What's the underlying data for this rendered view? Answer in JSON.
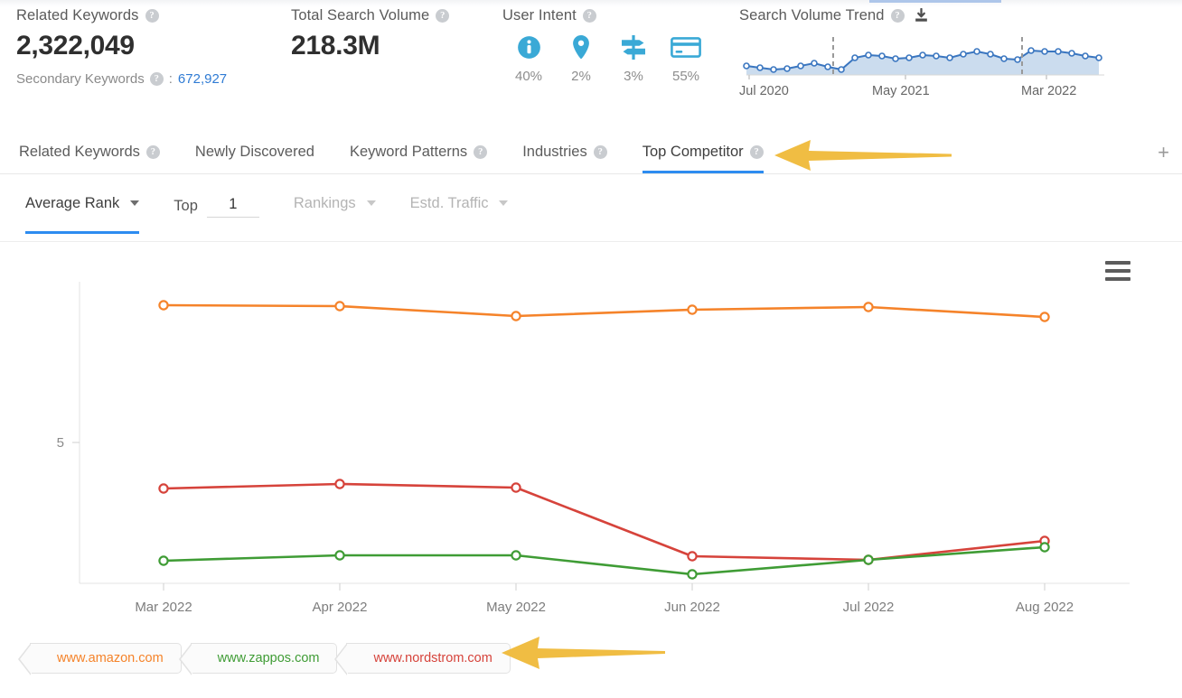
{
  "metrics": {
    "related_keywords": {
      "label": "Related Keywords",
      "value": "2,322,049",
      "secondary_label": "Secondary Keywords",
      "secondary_sep": ":",
      "secondary_value": "672,927",
      "help_icon": "question-mark-icon"
    },
    "total_search_volume": {
      "label": "Total Search Volume",
      "value": "218.3M",
      "help_icon": "question-mark-icon"
    },
    "user_intent": {
      "label": "User Intent",
      "help_icon": "question-mark-icon",
      "items": [
        {
          "icon": "info-circle-icon",
          "name": "informational",
          "pct": "40%"
        },
        {
          "icon": "map-pin-icon",
          "name": "navigational",
          "pct": "2%"
        },
        {
          "icon": "signpost-icon",
          "name": "transactional",
          "pct": "3%"
        },
        {
          "icon": "credit-card-icon",
          "name": "commercial",
          "pct": "55%"
        }
      ]
    },
    "search_volume_trend": {
      "label": "Search Volume Trend",
      "help_icon": "question-mark-icon",
      "download_icon": "download-icon",
      "axis_labels": [
        "Jul 2020",
        "May 2021",
        "Mar 2022"
      ]
    }
  },
  "tabs": {
    "items": [
      {
        "label": "Related Keywords",
        "help": true,
        "active": false
      },
      {
        "label": "Newly Discovered",
        "help": false,
        "active": false
      },
      {
        "label": "Keyword Patterns",
        "help": true,
        "active": false
      },
      {
        "label": "Industries",
        "help": true,
        "active": false
      },
      {
        "label": "Top Competitor",
        "help": true,
        "active": true
      }
    ],
    "add_tab_icon": "plus-icon"
  },
  "filters": {
    "average_rank": {
      "label": "Average Rank",
      "active": true,
      "caret": "chevron-down-icon"
    },
    "top": {
      "label": "Top",
      "value": "1"
    },
    "rankings": {
      "label": "Rankings",
      "muted": true,
      "caret": "chevron-down-icon"
    },
    "estd_traffic": {
      "label": "Estd. Traffic",
      "muted": true,
      "caret": "chevron-down-icon"
    }
  },
  "chart_menu_icon": "hamburger-menu-icon",
  "legend": {
    "items": [
      {
        "label": "www.amazon.com",
        "color": "#f5832a"
      },
      {
        "label": "www.zappos.com",
        "color": "#3f9c35"
      },
      {
        "label": "www.nordstrom.com",
        "color": "#d6433b"
      }
    ]
  },
  "annotations": {
    "color": "#f0bd43",
    "arrows": [
      {
        "name": "arrow-pointing-to-top-competitor-tab",
        "direction": "left"
      },
      {
        "name": "arrow-pointing-to-legend",
        "direction": "left"
      }
    ]
  },
  "chart_data": {
    "type": "line",
    "title": "",
    "xlabel": "",
    "ylabel": "",
    "categories": [
      "Mar 2022",
      "Apr 2022",
      "May 2022",
      "Jun 2022",
      "Jul 2022",
      "Aug 2022"
    ],
    "y_ticks": [
      "5"
    ],
    "y_tick_values": [
      5
    ],
    "y_inverted": true,
    "ylim": [
      0,
      9.5
    ],
    "grid": false,
    "legend_position": "bottom-left",
    "series": [
      {
        "name": "www.amazon.com",
        "color": "#f5832a",
        "values": [
          1.2,
          1.2,
          1.4,
          1.3,
          1.2,
          1.4
        ]
      },
      {
        "name": "www.nordstrom.com",
        "color": "#d6433b",
        "values": [
          6.4,
          6.3,
          6.4,
          8.4,
          8.5,
          8.2
        ]
      },
      {
        "name": "www.zappos.com",
        "color": "#3f9c35",
        "values": [
          8.8,
          8.6,
          8.6,
          9.0,
          8.5,
          8.3
        ]
      }
    ]
  },
  "sparkline_data": {
    "type": "area",
    "color": "#3a76c0",
    "fill": "#cbdcee",
    "values": [
      12,
      11,
      10,
      11,
      13,
      15,
      12,
      10,
      19,
      21,
      20,
      18,
      19,
      21,
      20,
      19,
      22,
      24,
      22,
      19,
      18,
      25,
      24,
      24,
      23,
      21
    ],
    "tick_labels": [
      "Jul 2020",
      "May 2021",
      "Mar 2022"
    ],
    "tick_positions": [
      0,
      10,
      20
    ],
    "marker_lines": [
      7,
      21
    ]
  }
}
